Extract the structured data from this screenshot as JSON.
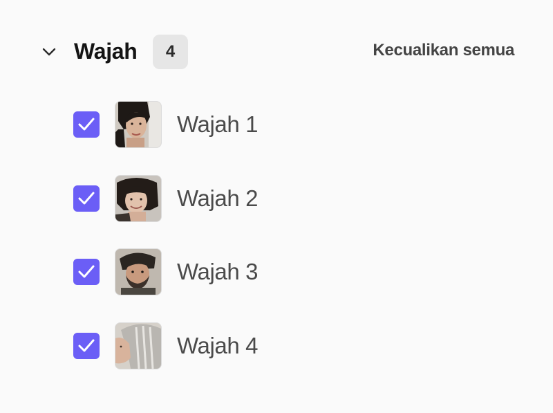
{
  "section": {
    "title": "Wajah",
    "count": "4",
    "exclude_all_label": "Kecualikan semua",
    "collapse_icon": "chevron-down-icon",
    "accent_color": "#6b5ef6"
  },
  "faces": [
    {
      "label": "Wajah 1",
      "checked": true
    },
    {
      "label": "Wajah 2",
      "checked": true
    },
    {
      "label": "Wajah 3",
      "checked": true
    },
    {
      "label": "Wajah 4",
      "checked": true
    }
  ]
}
